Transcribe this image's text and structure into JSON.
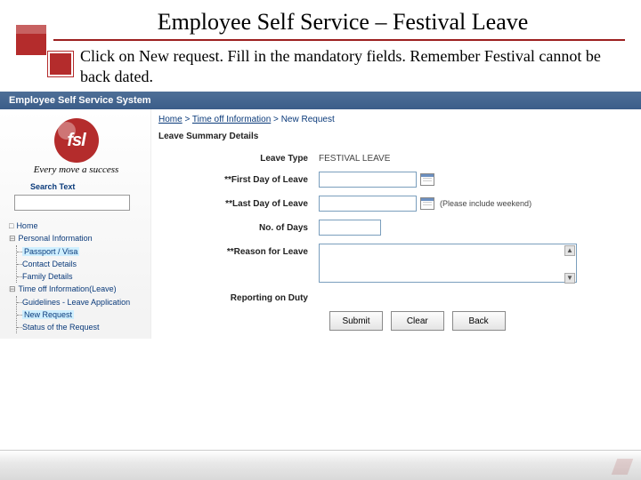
{
  "slide": {
    "title": "Employee Self Service – Festival Leave",
    "instruction": "Click on New request. Fill in the mandatory fields. Remember Festival cannot be back dated."
  },
  "systemBar": "Employee Self Service System",
  "sidebar": {
    "logoText": "fsl",
    "tagline": "Every move a success",
    "searchLabel": "Search Text",
    "tree": {
      "home": "Home",
      "personal": {
        "label": "Personal Information",
        "children": [
          "Passport / Visa",
          "Contact Details",
          "Family Details"
        ]
      },
      "timeoff": {
        "label": "Time off Information(Leave)",
        "children": [
          "Guidelines - Leave Application",
          "New Request",
          "Status of the Request"
        ]
      }
    }
  },
  "breadcrumb": {
    "home": "Home",
    "section": "Time off Information",
    "current": "New Request"
  },
  "panel": {
    "title": "Leave Summary Details"
  },
  "form": {
    "leaveType": {
      "label": "Leave Type",
      "value": "FESTIVAL LEAVE"
    },
    "firstDay": {
      "label": "**First Day of Leave",
      "value": ""
    },
    "lastDay": {
      "label": "**Last Day of Leave",
      "value": "",
      "hint": "(Please include weekend)"
    },
    "noDays": {
      "label": "No. of Days",
      "value": ""
    },
    "reason": {
      "label": "**Reason for Leave",
      "value": ""
    },
    "reporting": {
      "label": "Reporting on Duty",
      "value": ""
    }
  },
  "buttons": {
    "submit": "Submit",
    "clear": "Clear",
    "back": "Back"
  }
}
